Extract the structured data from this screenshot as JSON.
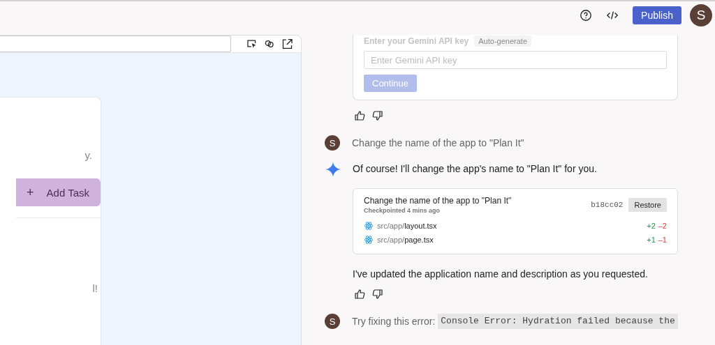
{
  "header": {
    "publish": "Publish",
    "avatar": "S"
  },
  "preview": {
    "partial_text_1": "y.",
    "add_button": "Add Task",
    "add_icon": "+",
    "partial_text_2": "l!"
  },
  "chat": {
    "api_card": {
      "label": "Enter your Gemini API key",
      "badge": "Auto-generate",
      "placeholder": "Enter Gemini API key",
      "button": "Continue"
    },
    "messages": [
      {
        "kind": "user",
        "avatar": "S",
        "text": "Change the name of the app to \"Plan It\""
      },
      {
        "kind": "model",
        "text": "Of course! I'll change the app's name to \"Plan It\" for you.",
        "checkpoint": {
          "title": "Change the name of the app to \"Plan It\"",
          "subtitle": "Checkpointed 4 mins ago",
          "hash": "b18cc02",
          "button": "Restore",
          "files": [
            {
              "dir": "src/app/",
              "name": "layout.tsx",
              "added": "+2",
              "removed": "–2"
            },
            {
              "dir": "src/app/",
              "name": "page.tsx",
              "added": "+1",
              "removed": "–1"
            }
          ]
        },
        "after": "I've updated the application name and description as you requested."
      },
      {
        "kind": "user",
        "avatar": "S",
        "text": "Try fixing this error:",
        "code": "Console Error: Hydration failed because the"
      }
    ]
  }
}
